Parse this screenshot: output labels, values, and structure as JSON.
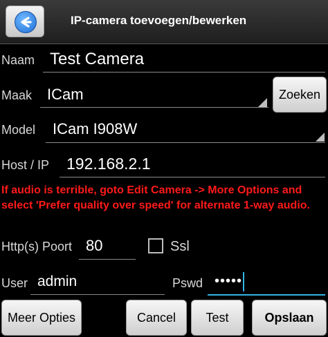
{
  "header": {
    "title": "IP-camera toevoegen/bewerken"
  },
  "form": {
    "naam": {
      "label": "Naam",
      "value": "Test Camera"
    },
    "maak": {
      "label": "Maak",
      "value": "ICam",
      "button": "Zoeken"
    },
    "model": {
      "label": "Model",
      "value": "ICam I908W"
    },
    "host": {
      "label": "Host / IP",
      "value": "192.168.2.1"
    },
    "warning": "If audio is terrible, goto Edit Camera -> More Options and select 'Prefer quality over speed' for alternate 1-way audio.",
    "port": {
      "label": "Http(s) Poort",
      "value": "80"
    },
    "ssl": {
      "label": "Ssl",
      "checked": false
    },
    "user": {
      "label": "User",
      "value": "admin"
    },
    "pswd": {
      "label": "Pswd",
      "masked": "•••••"
    }
  },
  "buttons": {
    "more": "Meer Opties",
    "cancel": "Cancel",
    "test": "Test",
    "save": "Opslaan"
  },
  "colors": {
    "warning": "#ff1a1a",
    "focus_underline": "#33b5e5",
    "icon": "back-arrow-icon"
  }
}
